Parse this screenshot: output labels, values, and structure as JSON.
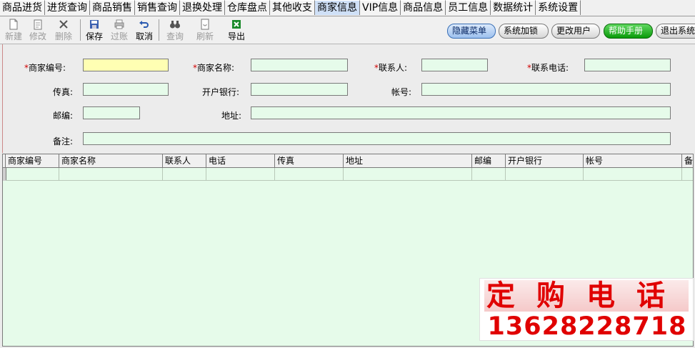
{
  "tabs": [
    "商品进货",
    "进货查询",
    "商品销售",
    "销售查询",
    "退换处理",
    "仓库盘点",
    "其他收支",
    "商家信息",
    "VIP信息",
    "商品信息",
    "员工信息",
    "数据统计",
    "系统设置"
  ],
  "active_tab": "商家信息",
  "toolbar": {
    "new_label": "新建",
    "edit_label": "修改",
    "delete_label": "删除",
    "save_label": "保存",
    "filter_label": "过账",
    "cancel_label": "取消",
    "query_label": "查询",
    "refresh_label": "刷新",
    "export_label": "导出",
    "hide_menu_label": "隐藏菜单",
    "lock_label": "系统加锁",
    "change_user_label": "更改用户",
    "help_label": "帮助手册",
    "exit_label": "退出系统"
  },
  "form": {
    "required_mark": "*",
    "code_label": "商家编号:",
    "name_label": "商家名称:",
    "contact_label": "联系人:",
    "phone_label": "联系电话:",
    "fax_label": "传真:",
    "bank_label": "开户银行:",
    "account_label": "帐号:",
    "zip_label": "邮编:",
    "address_label": "地址:",
    "note_label": "备注:",
    "code_value": "",
    "name_value": "",
    "contact_value": "",
    "phone_value": "",
    "fax_value": "",
    "bank_value": "",
    "account_value": "",
    "zip_value": "",
    "address_value": "",
    "note_value": ""
  },
  "grid": {
    "columns": [
      "商家编号",
      "商家名称",
      "联系人",
      "电话",
      "传真",
      "地址",
      "邮编",
      "开户银行",
      "帐号",
      "备"
    ]
  },
  "ad": {
    "title": "定购电话",
    "phone": "13628228718"
  },
  "colors": {
    "input_bg": "#e6fbea",
    "focus_bg": "#ffffb3",
    "required": "#d00000",
    "ad_red": "#e00000",
    "help_green": "#0a9a0a"
  }
}
